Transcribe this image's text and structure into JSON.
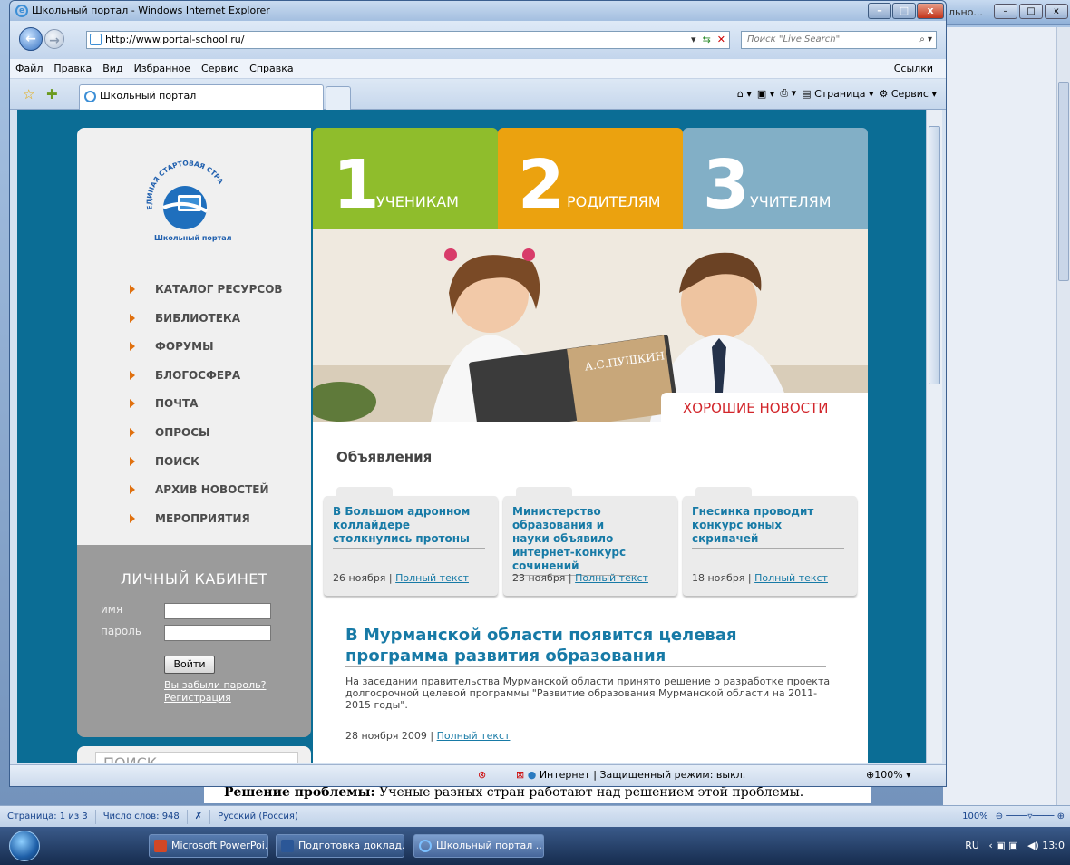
{
  "ie": {
    "window_title": "Школьный портал - Windows Internet Explorer",
    "url": "http://www.portal-school.ru/",
    "search_placeholder": "Поиск \"Live Search\"",
    "menu": [
      "Файл",
      "Правка",
      "Вид",
      "Избранное",
      "Сервис",
      "Справка"
    ],
    "links_label": "Ссылки",
    "tab_label": "Школьный портал",
    "cmd_page": "Страница",
    "cmd_service": "Сервис",
    "status_zone": "Интернет | Защищенный режим: выкл.",
    "zoom": "100%"
  },
  "page": {
    "tiles": [
      {
        "number": "1",
        "label": "УЧЕНИКАМ",
        "color": "#8fbd2c"
      },
      {
        "number": "2",
        "label": "РОДИТЕЛЯМ",
        "color": "#eba20f"
      },
      {
        "number": "3",
        "label": "УЧИТЕЛЯМ",
        "color": "#82afc6"
      }
    ],
    "logo_text": "Школьный портал",
    "logo_arc_text": "ЕДИНАЯ СТАРТОВАЯ СТРАНИЦА",
    "nav": [
      "КАТАЛОГ РЕСУРСОВ",
      "БИБЛИОТЕКА",
      "ФОРУМЫ",
      "БЛОГОСФЕРА",
      "ПОЧТА",
      "ОПРОСЫ",
      "ПОИСК",
      "АРХИВ НОВОСТЕЙ",
      "МЕРОПРИЯТИЯ"
    ],
    "cabinet": {
      "title": "ЛИЧНЫЙ КАБИНЕТ",
      "name_label": "имя",
      "password_label": "пароль",
      "login_button": "Войти",
      "forgot": "Вы забыли пароль?",
      "register": "Регистрация"
    },
    "search_label": "ПОИСК",
    "book_text": "А.С.ПУШКИН",
    "good_news": "ХОРОШИЕ НОВОСТИ",
    "announcements_title": "Объявления",
    "cards": [
      {
        "title": "В Большом адронном коллайдере столкнулись протоны",
        "date": "26 ноября",
        "link": "Полный текст"
      },
      {
        "title": "Министерство образования и науки объявило интернет-конкурс сочинений",
        "date": "23 ноября",
        "link": "Полный текст"
      },
      {
        "title": "Гнесинка проводит конкурс юных скрипачей",
        "date": "18 ноября",
        "link": "Полный текст"
      }
    ],
    "article": {
      "title": "В Мурманской области появится целевая программа развития образования",
      "text": "На заседании правительства Мурманской области принято решение о разработке проекта долгосрочной целевой программы \"Развитие образования Мурманской области на 2011-2015 годы\".",
      "date": "28 ноября 2009",
      "link": "Полный текст"
    }
  },
  "word": {
    "title_partial": "льно...",
    "doc_bold": "Решение проблемы:",
    "doc_text": " Ученые разных стран работают над решением этой  проблемы.",
    "status": [
      "Страница: 1 из 3",
      "Число слов: 948",
      "Русский (Россия)"
    ],
    "zoom": "100%"
  },
  "taskbar": {
    "items": [
      "Microsoft PowerPoi...",
      "Подготовка доклад...",
      "Школьный портал ..."
    ],
    "lang": "RU",
    "time": "13:0"
  }
}
